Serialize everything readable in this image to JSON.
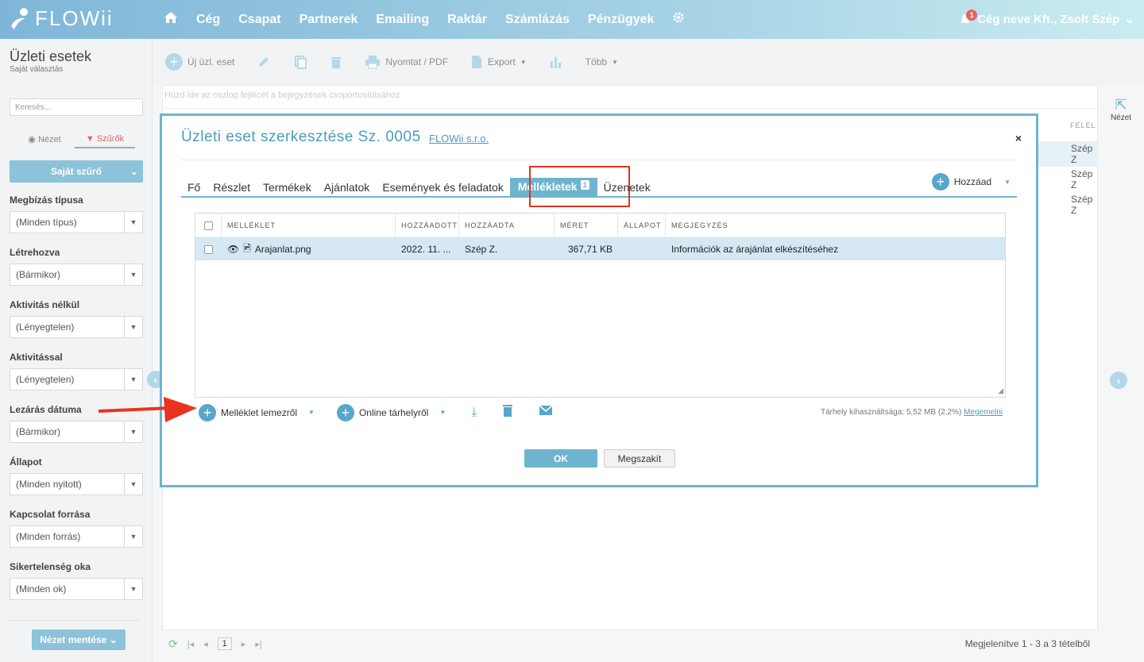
{
  "topbar": {
    "logo": "FLOWii",
    "nav": [
      "Cég",
      "Csapat",
      "Partnerek",
      "Emailing",
      "Raktár",
      "Számlázás",
      "Pénzügyek"
    ],
    "notification_count": "1",
    "user": "Cég neve Kft., Zsolt Szép"
  },
  "sidebar": {
    "title": "Üzleti esetek",
    "subtitle": "Saját választás",
    "search_placeholder": "Keresés...",
    "tab_view": "Nézet",
    "tab_filters": "Szűrők",
    "saved_filter": "Saját szűrő",
    "filters": [
      {
        "label": "Megbízás típusa",
        "value": "(Minden típus)"
      },
      {
        "label": "Létrehozva",
        "value": "(Bármikor)"
      },
      {
        "label": "Aktivitás nélkül",
        "value": "(Lényegtelen)"
      },
      {
        "label": "Aktivitással",
        "value": "(Lényegtelen)"
      },
      {
        "label": "Lezárás dátuma",
        "value": "(Bármikor)"
      },
      {
        "label": "Állapot",
        "value": "(Minden nyitott)"
      },
      {
        "label": "Kapcsolat forrása",
        "value": "(Minden forrás)"
      },
      {
        "label": "Sikertelenség oka",
        "value": "(Minden ok)"
      }
    ],
    "save_view": "Nézet mentése"
  },
  "toolbar": {
    "new": "Új üzl. eset",
    "print": "Nyomtat / PDF",
    "export": "Export",
    "more": "Több"
  },
  "grid": {
    "group_hint": "Húzd ide az oszlop fejlécét a bejegyzések csoportosításához",
    "col_header_partial": "FELEL",
    "bg_rows": [
      "Szép Z",
      "Szép Z",
      "Szép Z"
    ]
  },
  "right_rail": {
    "view": "Nézet"
  },
  "pager": {
    "page": "1",
    "info": "Megjelenítve 1 - 3 a 3 tételből"
  },
  "modal": {
    "title": "Üzleti eset szerkesztése Sz. 0005",
    "company_link": "FLOWii s.r.o.",
    "tabs": [
      "Fő",
      "Részlet",
      "Termékek",
      "Ajánlatok",
      "Események és feladatok",
      "Mellékletek",
      "Üzenetek"
    ],
    "active_tab_badge": "1",
    "add_label": "Hozzáad",
    "table": {
      "headers": [
        "MELLÉKLET",
        "HOZZÁADOTT",
        "HOZZÁADTA",
        "MÉRET",
        "ÁLLAPOT",
        "MEGJEGYZÉS"
      ],
      "rows": [
        {
          "name": "Arajanlat.png",
          "added": "2022. 11. ...",
          "added_by": "Szép Z.",
          "size": "367,71 KB",
          "status": "",
          "note": "Információk az árajánlat elkészítéséhez"
        }
      ]
    },
    "actions": {
      "from_disk": "Melléklet lemezről",
      "from_online": "Online tárhelyről"
    },
    "storage_text": "Tárhely kihasználtsága: 5,52 MB (2,2%)",
    "storage_link": "Megemelni",
    "ok": "OK",
    "cancel": "Megszakít"
  },
  "colors": {
    "accent": "#6fb4cf",
    "highlight": "#e0341e",
    "badge": "#e06666"
  }
}
